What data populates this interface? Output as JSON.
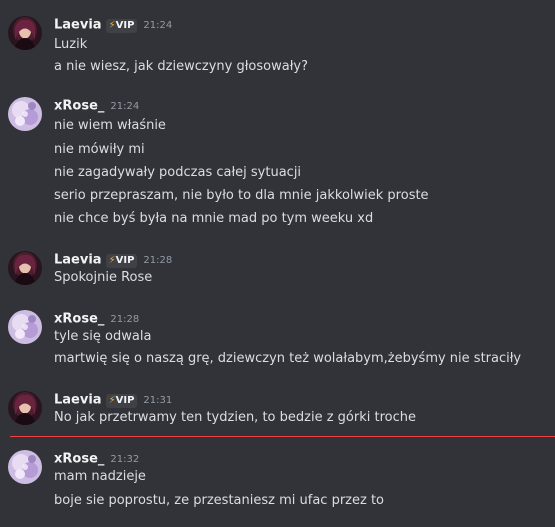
{
  "colors": {
    "background": "#313338",
    "username": "#f2f3f5",
    "text": "#dbdee1",
    "timestamp": "#949ba4",
    "vip_badge_bg": "#3f4147",
    "vip_icon": "#f0b232",
    "new_messages_divider": "#f23f43"
  },
  "badge_icon": "lightning-bolt-icon",
  "groups": [
    {
      "username": "Laevia",
      "badge": "VIP",
      "time": "21:24",
      "lines": [
        "Luzik",
        "a nie wiesz, jak dziewczyny głosowały?"
      ]
    },
    {
      "username": "xRose_",
      "time": "21:24",
      "lines": [
        "nie wiem właśnie",
        "nie mówiły mi",
        "nie zagadywały podczas całej sytuacji",
        "serio przepraszam, nie było to dla mnie jakkolwiek proste",
        "nie chce byś była na mnie mad po tym weeku xd"
      ]
    },
    {
      "username": "Laevia",
      "badge": "VIP",
      "time": "21:28",
      "lines": [
        "Spokojnie Rose"
      ]
    },
    {
      "username": "xRose_",
      "time": "21:28",
      "lines": [
        "tyle się odwala",
        "martwię się o naszą grę, dziewczyn też wolałabym,żebyśmy nie straciły"
      ]
    },
    {
      "username": "Laevia",
      "badge": "VIP",
      "time": "21:31",
      "lines": [
        "No jak przetrwamy ten tydzien, to bedzie z górki troche"
      ]
    },
    {
      "username": "xRose_",
      "time": "21:32",
      "lines": [
        "mam nadzieje",
        "boje sie poprostu, ze przestaniesz mi ufac przez to"
      ]
    }
  ]
}
